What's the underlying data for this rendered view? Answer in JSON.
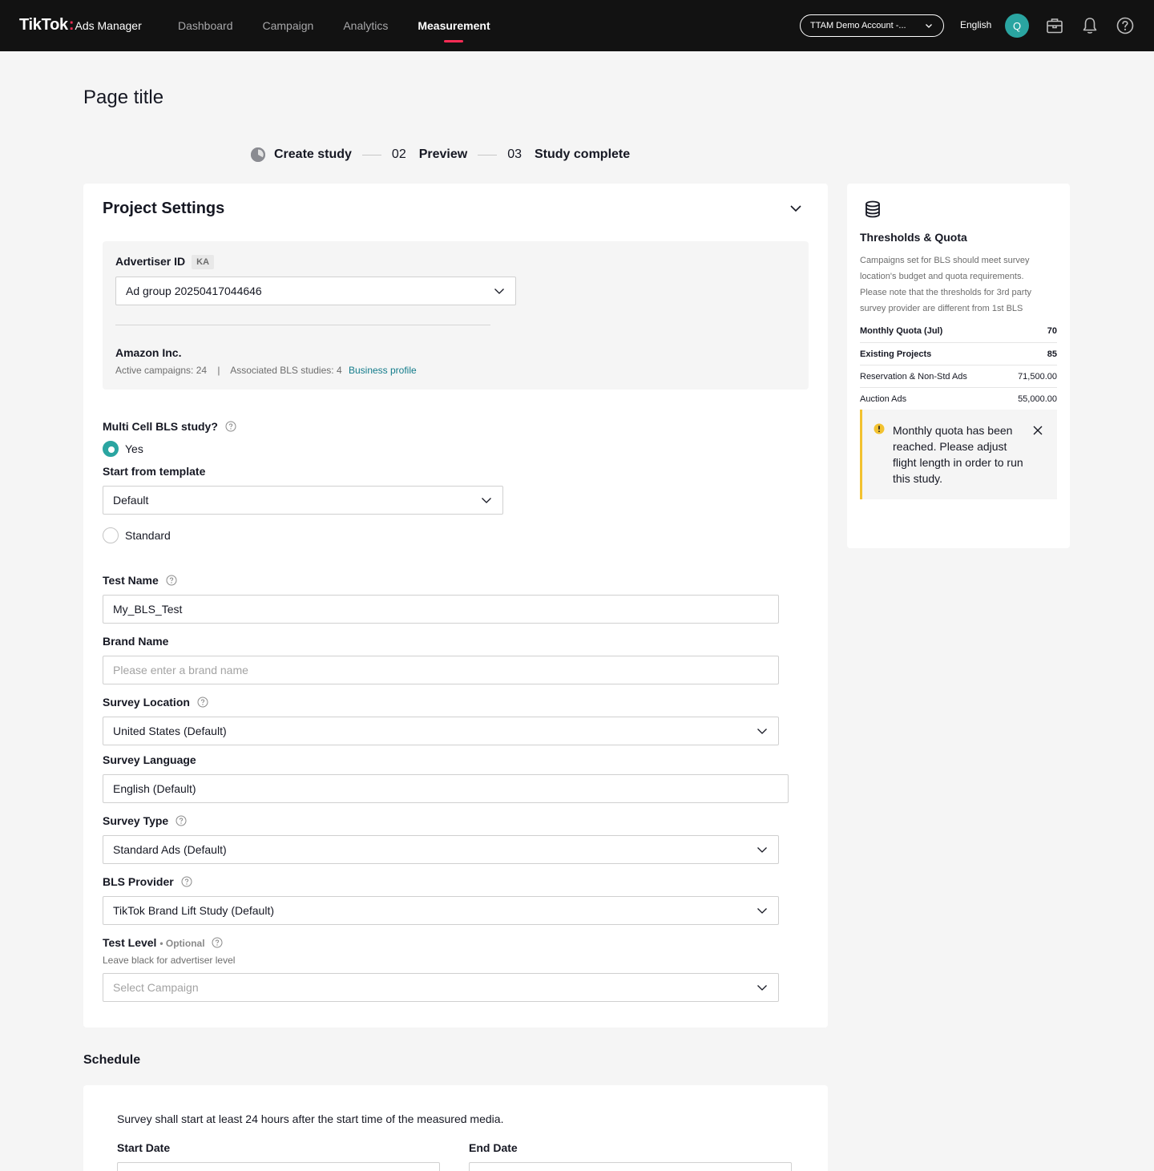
{
  "nav": {
    "logo_main": "TikTok",
    "logo_dot": ":",
    "logo_sub": "Ads Manager",
    "items": [
      "Dashboard",
      "Campaign",
      "Analytics",
      "Measurement"
    ],
    "active_index": 3,
    "account": "TTAM Demo Account -...",
    "language": "English",
    "avatar_initial": "Q",
    "icons": [
      "briefcase-icon",
      "bell-icon",
      "help-circle-icon"
    ],
    "accent_color": "#fe2c55"
  },
  "page": {
    "title": "Page title"
  },
  "stepper": {
    "steps": [
      {
        "num": "",
        "label": "Create study",
        "state": "current"
      },
      {
        "num": "02",
        "label": "Preview",
        "state": "upcoming"
      },
      {
        "num": "03",
        "label": "Study complete",
        "state": "upcoming"
      }
    ]
  },
  "project": {
    "heading": "Project Settings",
    "advertiser": {
      "label": "Advertiser ID",
      "badge": "KA",
      "selected": "Ad group 20250417044646",
      "company": "Amazon Inc.",
      "active_campaigns": "Active campaigns: 24",
      "separator": "|",
      "associated_studies": "Associated BLS studies: 4",
      "profile_link": "Business profile"
    },
    "multi_cell": {
      "label": "Multi Cell BLS study?",
      "yes_label": "Yes",
      "template_label": "Start from template",
      "template_value": "Default",
      "standard_label": "Standard"
    },
    "test_name": {
      "label": "Test Name",
      "value": "My_BLS_Test"
    },
    "brand_name": {
      "label": "Brand Name",
      "placeholder": "Please enter a brand name"
    },
    "survey_location": {
      "label": "Survey Location",
      "value": "United States (Default)"
    },
    "survey_language": {
      "label": "Survey Language",
      "value": "English (Default)"
    },
    "survey_type": {
      "label": "Survey Type",
      "value": "Standard Ads (Default)"
    },
    "bls_provider": {
      "label": "BLS Provider",
      "value": "TikTok Brand Lift Study (Default)"
    },
    "test_level": {
      "label": "Test Level",
      "optional": "• Optional",
      "hint": "Leave black for advertiser level",
      "placeholder": "Select Campaign"
    }
  },
  "quota": {
    "title": "Thresholds & Quota",
    "description": "Campaigns set for BLS should meet survey location's budget and quota requirements. Please note that the thresholds for 3rd party survey provider are different from 1st BLS",
    "rows": [
      {
        "label": "Monthly Quota (Jul)",
        "value": "70"
      },
      {
        "label": "Existing Projects",
        "value": "85"
      },
      {
        "label": "Reservation & Non-Std Ads",
        "value": "71,500.00"
      },
      {
        "label": "Auction Ads",
        "value": "55,000.00"
      }
    ],
    "alert": "Monthly quota has been reached. Please adjust flight length in order to run this study.",
    "alert_color": "#f2c230"
  },
  "schedule": {
    "title": "Schedule",
    "note": "Survey shall start at least 24 hours after the start time of the measured media.",
    "start_label": "Start Date",
    "end_label": "End Date"
  }
}
